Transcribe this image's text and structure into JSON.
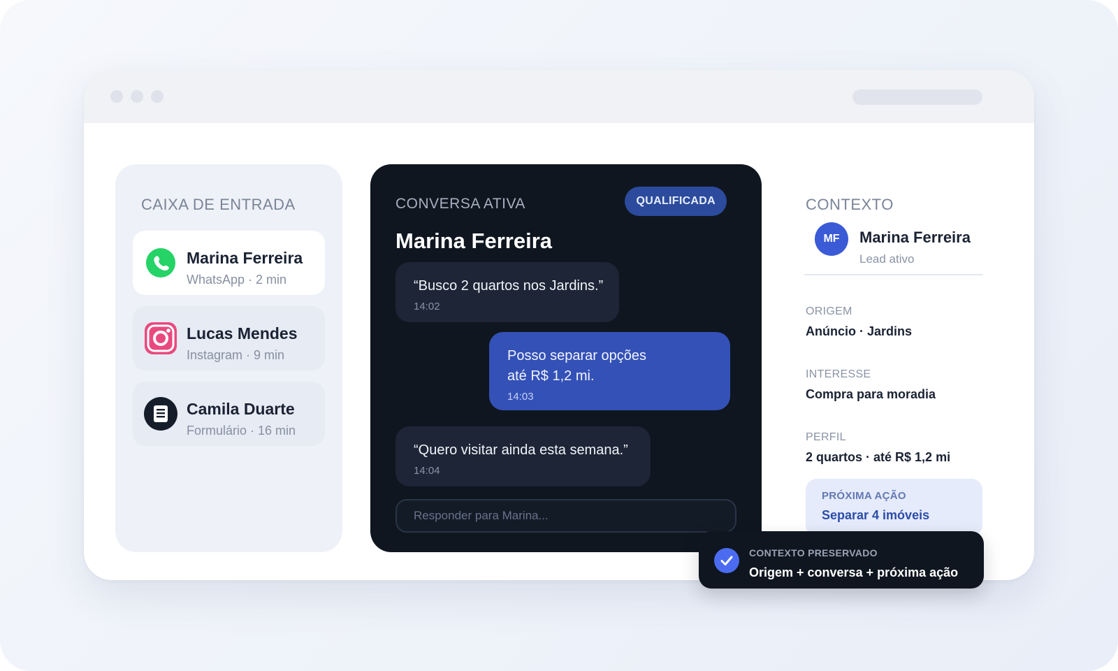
{
  "inbox": {
    "title": "CAIXA DE ENTRADA",
    "items": [
      {
        "name": "Marina Ferreira",
        "meta": "WhatsApp · 2 min",
        "icon": "whatsapp-icon"
      },
      {
        "name": "Lucas Mendes",
        "meta": "Instagram · 9 min",
        "icon": "instagram-icon"
      },
      {
        "name": "Camila Duarte",
        "meta": "Formulário · 16 min",
        "icon": "form-icon"
      }
    ]
  },
  "conversation": {
    "label": "CONVERSA ATIVA",
    "badge": "QUALIFICADA",
    "title": "Marina Ferreira",
    "messages": [
      {
        "direction": "in",
        "lines": [
          "“Busco 2 quartos nos Jardins.”"
        ],
        "time": "14:02"
      },
      {
        "direction": "out",
        "lines": [
          "Posso separar opções",
          "até R$ 1,2 mi."
        ],
        "time": "14:03"
      },
      {
        "direction": "in",
        "lines": [
          "“Quero visitar ainda esta semana.”"
        ],
        "time": "14:04"
      }
    ],
    "reply_placeholder": "Responder para Marina..."
  },
  "context": {
    "title": "CONTEXTO",
    "avatar_initials": "MF",
    "name": "Marina Ferreira",
    "status": "Lead ativo",
    "fields": [
      {
        "label": "ORIGEM",
        "value": "Anúncio · Jardins"
      },
      {
        "label": "INTERESSE",
        "value": "Compra para moradia"
      },
      {
        "label": "PERFIL",
        "value": "2 quartos · até R$ 1,2 mi"
      }
    ],
    "next_action": {
      "label": "PRÓXIMA AÇÃO",
      "value": "Separar 4 imóveis"
    }
  },
  "toast": {
    "label": "CONTEXTO PRESERVADO",
    "text": "Origem + conversa + próxima ação",
    "icon": "check-icon"
  },
  "colors": {
    "accent": "#3451b7",
    "dark": "#0f161f",
    "whatsapp": "#25d366",
    "instagram": "#e84a7f"
  }
}
